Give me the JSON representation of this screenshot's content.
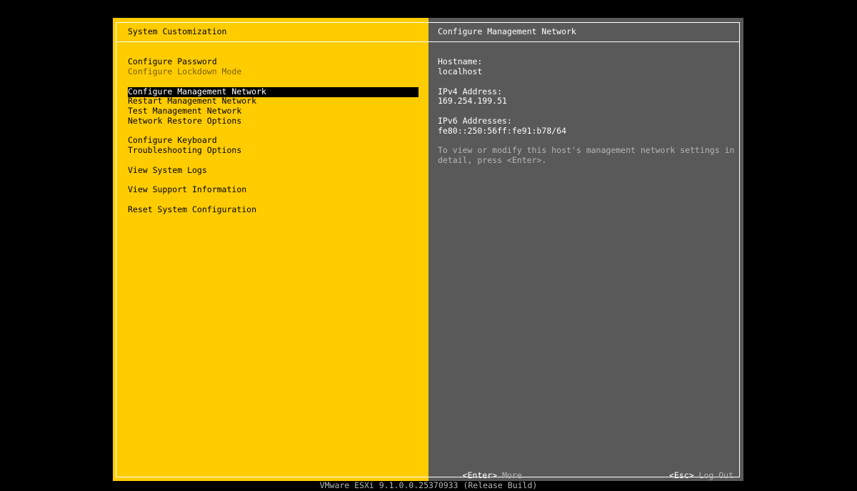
{
  "left": {
    "title": "System Customization",
    "menu": [
      {
        "label": "Configure Password",
        "state": "normal"
      },
      {
        "label": "Configure Lockdown Mode",
        "state": "disabled"
      },
      {
        "label": "Configure Management Network",
        "state": "selected"
      },
      {
        "label": "Restart Management Network",
        "state": "normal"
      },
      {
        "label": "Test Management Network",
        "state": "normal"
      },
      {
        "label": "Network Restore Options",
        "state": "normal"
      },
      {
        "label": "Configure Keyboard",
        "state": "normal"
      },
      {
        "label": "Troubleshooting Options",
        "state": "normal"
      },
      {
        "label": "View System Logs",
        "state": "normal"
      },
      {
        "label": "View Support Information",
        "state": "normal"
      },
      {
        "label": "Reset System Configuration",
        "state": "normal"
      }
    ]
  },
  "right": {
    "title": "Configure Management Network",
    "hostname_label": "Hostname:",
    "hostname_value": "localhost",
    "ipv4_label": "IPv4 Address:",
    "ipv4_value": "169.254.199.51",
    "ipv6_label": "IPv6 Addresses:",
    "ipv6_value": "fe80::250:56ff:fe91:b78/64",
    "help": "To view or modify this host's management network settings in\ndetail, press <Enter>.",
    "footer": {
      "enter_key": "<Enter>",
      "enter_action": "More",
      "esc_key": "<Esc>",
      "esc_action": "Log Out"
    }
  },
  "version": "VMware ESXi 9.1.0.0.25370933 (Release Build)",
  "colors": {
    "yellow": "#ffcc00",
    "gray": "#595959",
    "background": "#000000"
  }
}
